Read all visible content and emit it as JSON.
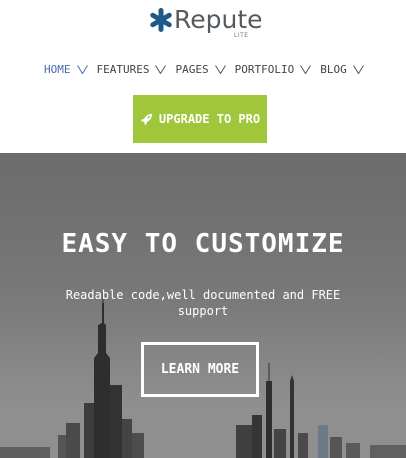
{
  "brand": {
    "name": "Repute",
    "edition": "LITE",
    "icon": "asterisk-logo-icon",
    "color": "#1b5a8a"
  },
  "nav": {
    "items": [
      {
        "label": "HOME",
        "active": true
      },
      {
        "label": "FEATURES",
        "active": false
      },
      {
        "label": "PAGES",
        "active": false
      },
      {
        "label": "PORTFOLIO",
        "active": false
      },
      {
        "label": "BLOG",
        "active": false
      }
    ],
    "active_color": "#4a6ea8"
  },
  "upgrade": {
    "label": "UPGRADE TO PRO",
    "icon": "rocket-icon",
    "color": "#a0c73b"
  },
  "hero": {
    "title": "EASY TO CUSTOMIZE",
    "subtitle": "Readable code,well documented and FREE support",
    "button_label": "LEARN MORE"
  }
}
